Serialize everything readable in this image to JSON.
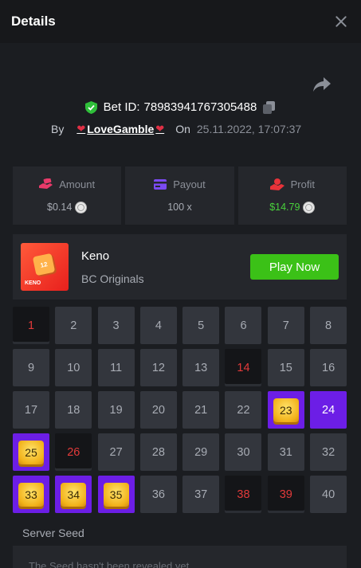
{
  "header": {
    "title": "Details"
  },
  "bet": {
    "label": "Bet ID:",
    "id": "78983941767305488"
  },
  "by": {
    "label": "By",
    "username": "LoveGamble",
    "on_label": "On",
    "date": "25.11.2022, 17:07:37"
  },
  "stats": {
    "amount": {
      "label": "Amount",
      "value": "$0.14"
    },
    "payout": {
      "label": "Payout",
      "value": "100 x"
    },
    "profit": {
      "label": "Profit",
      "value": "$14.79"
    }
  },
  "game": {
    "name": "Keno",
    "provider": "BC Originals",
    "play_label": "Play Now",
    "thumb_number": "12",
    "thumb_tag": "KENO"
  },
  "grid": {
    "cells": [
      {
        "n": "1",
        "state": "miss"
      },
      {
        "n": "2",
        "state": "normal"
      },
      {
        "n": "3",
        "state": "normal"
      },
      {
        "n": "4",
        "state": "normal"
      },
      {
        "n": "5",
        "state": "normal"
      },
      {
        "n": "6",
        "state": "normal"
      },
      {
        "n": "7",
        "state": "normal"
      },
      {
        "n": "8",
        "state": "normal"
      },
      {
        "n": "9",
        "state": "normal"
      },
      {
        "n": "10",
        "state": "normal"
      },
      {
        "n": "11",
        "state": "normal"
      },
      {
        "n": "12",
        "state": "normal"
      },
      {
        "n": "13",
        "state": "normal"
      },
      {
        "n": "14",
        "state": "miss"
      },
      {
        "n": "15",
        "state": "normal"
      },
      {
        "n": "16",
        "state": "normal"
      },
      {
        "n": "17",
        "state": "normal"
      },
      {
        "n": "18",
        "state": "normal"
      },
      {
        "n": "19",
        "state": "normal"
      },
      {
        "n": "20",
        "state": "normal"
      },
      {
        "n": "21",
        "state": "normal"
      },
      {
        "n": "22",
        "state": "normal"
      },
      {
        "n": "23",
        "state": "hit-gem"
      },
      {
        "n": "24",
        "state": "hit"
      },
      {
        "n": "25",
        "state": "hit-gem"
      },
      {
        "n": "26",
        "state": "miss"
      },
      {
        "n": "27",
        "state": "normal"
      },
      {
        "n": "28",
        "state": "normal"
      },
      {
        "n": "29",
        "state": "normal"
      },
      {
        "n": "30",
        "state": "normal"
      },
      {
        "n": "31",
        "state": "normal"
      },
      {
        "n": "32",
        "state": "normal"
      },
      {
        "n": "33",
        "state": "hit-gem"
      },
      {
        "n": "34",
        "state": "hit-gem"
      },
      {
        "n": "35",
        "state": "hit-gem"
      },
      {
        "n": "36",
        "state": "normal"
      },
      {
        "n": "37",
        "state": "normal"
      },
      {
        "n": "38",
        "state": "miss"
      },
      {
        "n": "39",
        "state": "miss"
      },
      {
        "n": "40",
        "state": "normal"
      }
    ]
  },
  "seed": {
    "label": "Server Seed",
    "text": "The Seed hasn't been revealed yet"
  },
  "colors": {
    "accent_green": "#3bc117",
    "hit_purple": "#6c1ee6",
    "miss_red": "#e33a3a",
    "profit_green": "#49d13c"
  },
  "icons": {
    "close": "close-icon",
    "share": "share-icon",
    "shield": "shield-check-icon",
    "copy": "copy-icon",
    "amount": "money-hand-icon",
    "payout": "card-icon",
    "profit": "coins-hand-icon",
    "coin": "coin-icon"
  }
}
